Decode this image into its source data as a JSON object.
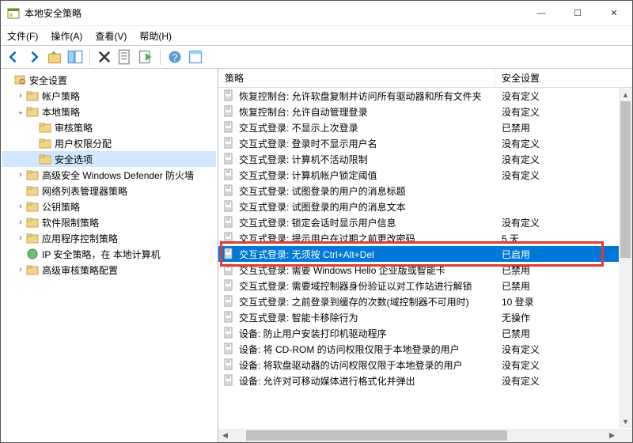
{
  "window": {
    "title": "本地安全策略",
    "min": "—",
    "max": "☐",
    "close": "✕"
  },
  "menu": {
    "file": "文件(F)",
    "action": "操作(A)",
    "view": "查看(V)",
    "help": "帮助(H)"
  },
  "tree": {
    "root": "安全设置",
    "acct": "帐户策略",
    "local": "本地策略",
    "audit": "审核策略",
    "userr": "用户权限分配",
    "secopt": "安全选项",
    "wdf": "高级安全 Windows Defender 防火墙",
    "netlm": "网络列表管理器策略",
    "pkp": "公钥策略",
    "swr": "软件限制策略",
    "appctl": "应用程序控制策略",
    "ipsec": "IP 安全策略，在 本地计算机",
    "advaud": "高级审核策略配置"
  },
  "columns": {
    "policy": "策略",
    "setting": "安全设置"
  },
  "policies": [
    {
      "name": "恢复控制台: 允许软盘复制并访问所有驱动器和所有文件夹",
      "value": "没有定义"
    },
    {
      "name": "恢复控制台: 允许自动管理登录",
      "value": "没有定义"
    },
    {
      "name": "交互式登录: 不显示上次登录",
      "value": "已禁用"
    },
    {
      "name": "交互式登录: 登录时不显示用户名",
      "value": "没有定义"
    },
    {
      "name": "交互式登录: 计算机不活动限制",
      "value": "没有定义"
    },
    {
      "name": "交互式登录: 计算机帐户锁定阈值",
      "value": "没有定义"
    },
    {
      "name": "交互式登录: 试图登录的用户的消息标题",
      "value": ""
    },
    {
      "name": "交互式登录: 试图登录的用户的消息文本",
      "value": ""
    },
    {
      "name": "交互式登录: 锁定会话时显示用户信息",
      "value": "没有定义"
    },
    {
      "name": "交互式登录: 提示用户在过期之前更改密码",
      "value": "5 天"
    },
    {
      "name": "交互式登录: 无须按 Ctrl+Alt+Del",
      "value": "已启用"
    },
    {
      "name": "交互式登录: 需要 Windows Hello 企业版或智能卡",
      "value": "已禁用"
    },
    {
      "name": "交互式登录: 需要域控制器身份验证以对工作站进行解锁",
      "value": "已禁用"
    },
    {
      "name": "交互式登录: 之前登录到缓存的次数(域控制器不可用时)",
      "value": "10 登录"
    },
    {
      "name": "交互式登录: 智能卡移除行为",
      "value": "无操作"
    },
    {
      "name": "设备: 防止用户安装打印机驱动程序",
      "value": "已禁用"
    },
    {
      "name": "设备: 将 CD-ROM 的访问权限仅限于本地登录的用户",
      "value": "没有定义"
    },
    {
      "name": "设备: 将软盘驱动器的访问权限仅限于本地登录的用户",
      "value": "没有定义"
    },
    {
      "name": "设备: 允许对可移动媒体进行格式化并弹出",
      "value": "没有定义"
    }
  ],
  "highlight": {
    "selected_index": 10,
    "redbox_index": 10
  }
}
